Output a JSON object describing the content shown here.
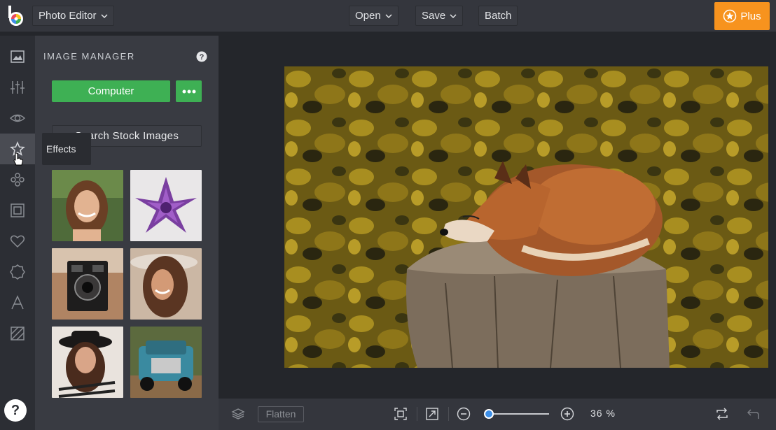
{
  "topbar": {
    "app_name": "Photo Editor",
    "open_label": "Open",
    "save_label": "Save",
    "batch_label": "Batch",
    "plus_label": "Plus"
  },
  "panel": {
    "title": "IMAGE MANAGER",
    "computer_label": "Computer",
    "stock_label": "Search Stock Images",
    "tooltip": "Effects",
    "thumbnails": [
      "woman-portrait",
      "purple-succulent",
      "vintage-camera",
      "woman-in-hat-laughing",
      "woman-black-hat",
      "vintage-blue-truck"
    ]
  },
  "rail": [
    "image",
    "adjust",
    "eye",
    "effects-star",
    "artsy",
    "frame",
    "heart",
    "badge",
    "text",
    "texture"
  ],
  "bottombar": {
    "flatten_label": "Flatten",
    "zoom": "36 %"
  },
  "colors": {
    "accent_green": "#3eb054",
    "accent_orange": "#f7931e",
    "slider_blue": "#3d8fe8"
  }
}
